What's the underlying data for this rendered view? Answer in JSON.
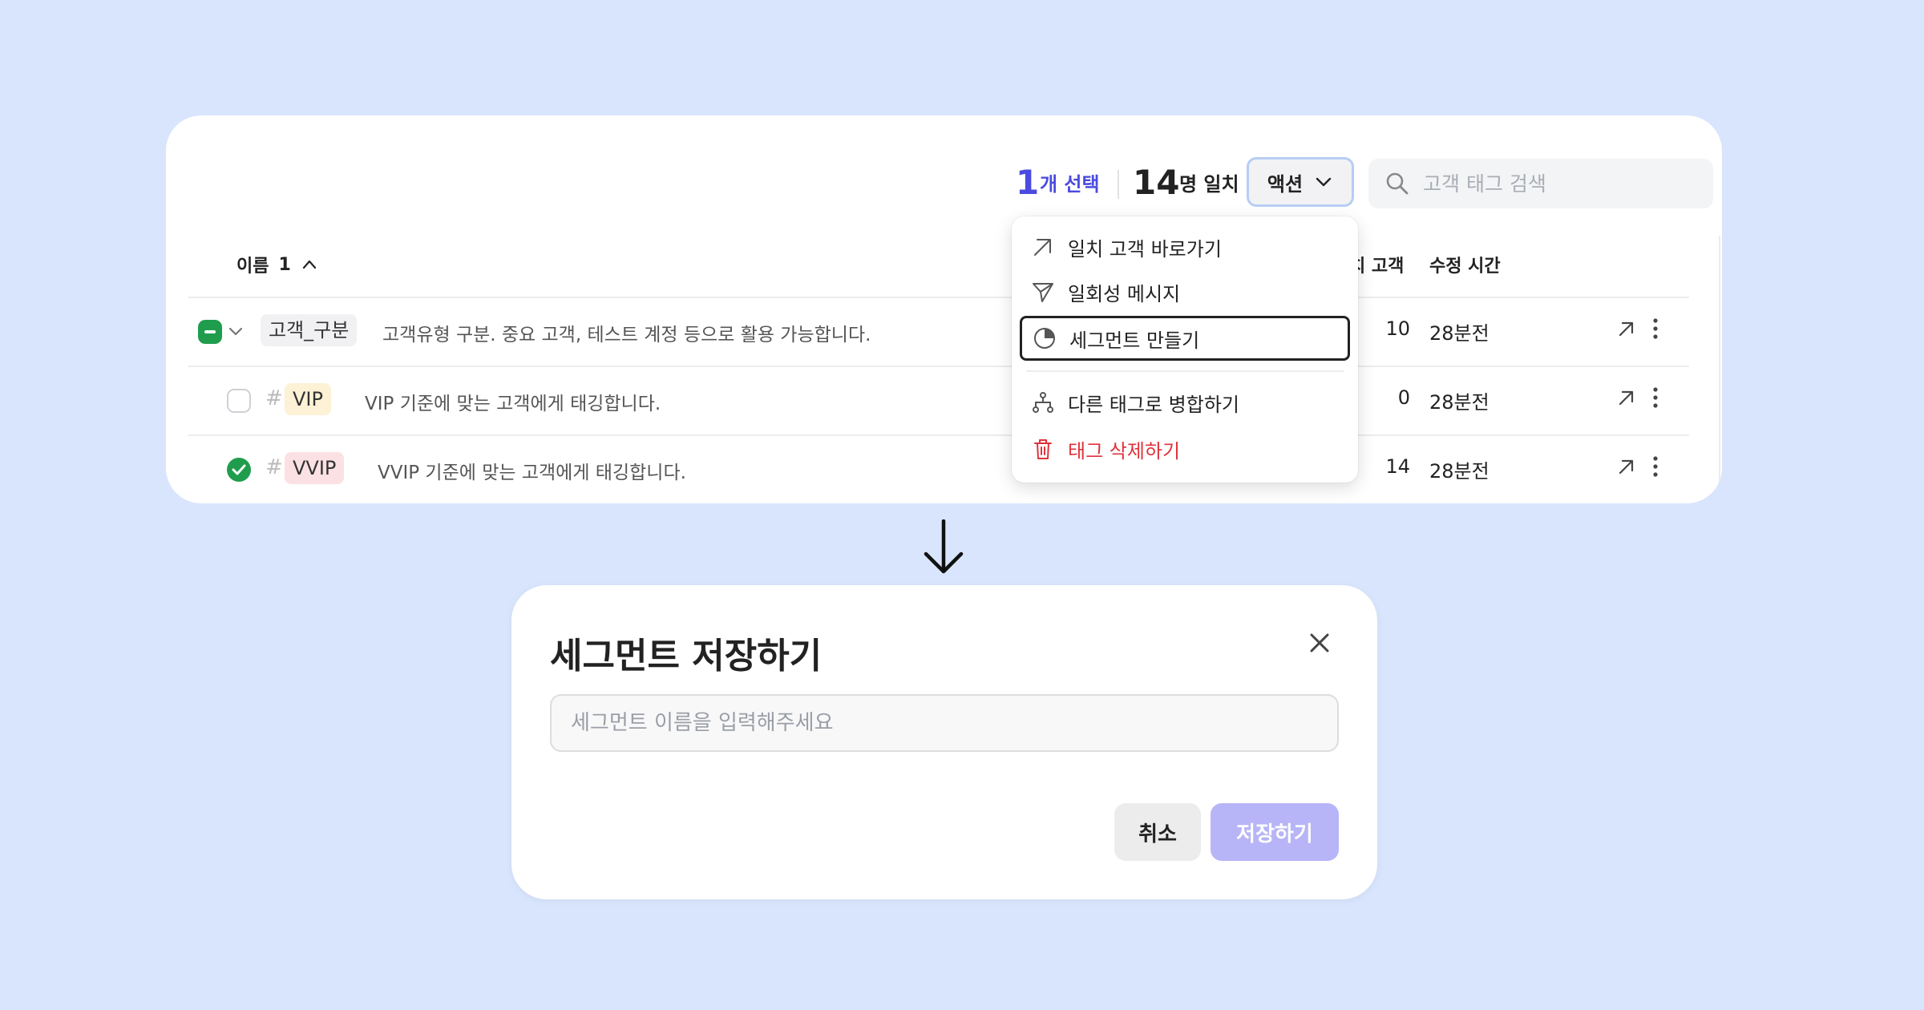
{
  "toolbar": {
    "selected_count": "1",
    "selected_label": "개 선택",
    "match_count": "14",
    "match_label": "명 일치",
    "action_label": "액션",
    "search_placeholder": "고객 태그 검색"
  },
  "table": {
    "header_name": "이름",
    "header_sort_count": "1",
    "header_match": "치 고객",
    "header_time": "수정 시간",
    "rows": [
      {
        "tag": "고객_구분",
        "description": "고객유형 구분. 중요 고객, 테스트 계정 등으로 활용 가능합니다.",
        "count": "10",
        "modified": "28분전",
        "checked": "partial"
      },
      {
        "tag": "VIP",
        "description": "VIP 기준에 맞는 고객에게 태깅합니다.",
        "count": "0",
        "modified": "28분전",
        "checked": "none"
      },
      {
        "tag": "VVIP",
        "description": "VVIP 기준에 맞는 고객에게 태깅합니다.",
        "count": "14",
        "modified": "28분전",
        "checked": "checked"
      }
    ]
  },
  "dropdown": {
    "items": [
      {
        "label": "일치 고객 바로가기",
        "icon": "arrow-up-right-icon"
      },
      {
        "label": "일회성 메시지",
        "icon": "send-icon"
      },
      {
        "label": "세그먼트 만들기",
        "icon": "pie-chart-icon"
      },
      {
        "label": "다른 태그로 병합하기",
        "icon": "merge-icon"
      },
      {
        "label": "태그 삭제하기",
        "icon": "trash-icon"
      }
    ]
  },
  "modal": {
    "title": "세그먼트 저장하기",
    "input_placeholder": "세그먼트 이름을 입력해주세요",
    "input_value": "",
    "cancel_label": "취소",
    "save_label": "저장하기"
  },
  "colors": {
    "background": "#d8e5fd",
    "accent": "#4b4be0",
    "check_green": "#1f9d4c",
    "danger": "#e0323b",
    "save_disabled": "#b7b5f7",
    "vip_chip": "#fdf1d6",
    "vvip_chip": "#fbe1e4"
  }
}
